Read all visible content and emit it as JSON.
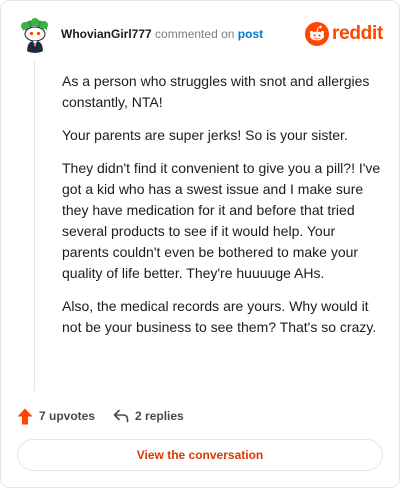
{
  "comment": {
    "username": "WhovianGirl777",
    "action_text": "commented on",
    "post_link": "post",
    "paragraphs": [
      "As a person who struggles with snot and allergies constantly, NTA!",
      "Your parents are super jerks! So is your sister.",
      "They didn't find it convenient to give you a pill?! I've got a kid who has a swest issue and I make sure they have medication for it and before that tried several products to see if it would help. Your parents couldn't even be bothered to make your quality of life better. They're huuuuge AHs.",
      "Also, the medical records are yours. Why would it not be your business to see them? That's so crazy."
    ]
  },
  "brand": {
    "wordmark": "reddit",
    "color": "#ff4500"
  },
  "footer": {
    "upvotes": "7 upvotes",
    "replies": "2 replies"
  },
  "cta": {
    "label": "View the conversation"
  },
  "icons": {
    "avatar": "snoo-avatar-icon",
    "logo": "reddit-logo-icon",
    "upvote": "upvote-arrow-icon",
    "reply": "reply-arrow-icon"
  },
  "colors": {
    "accent": "#ff4500",
    "link": "#0079d3",
    "cta_text": "#d93900"
  }
}
